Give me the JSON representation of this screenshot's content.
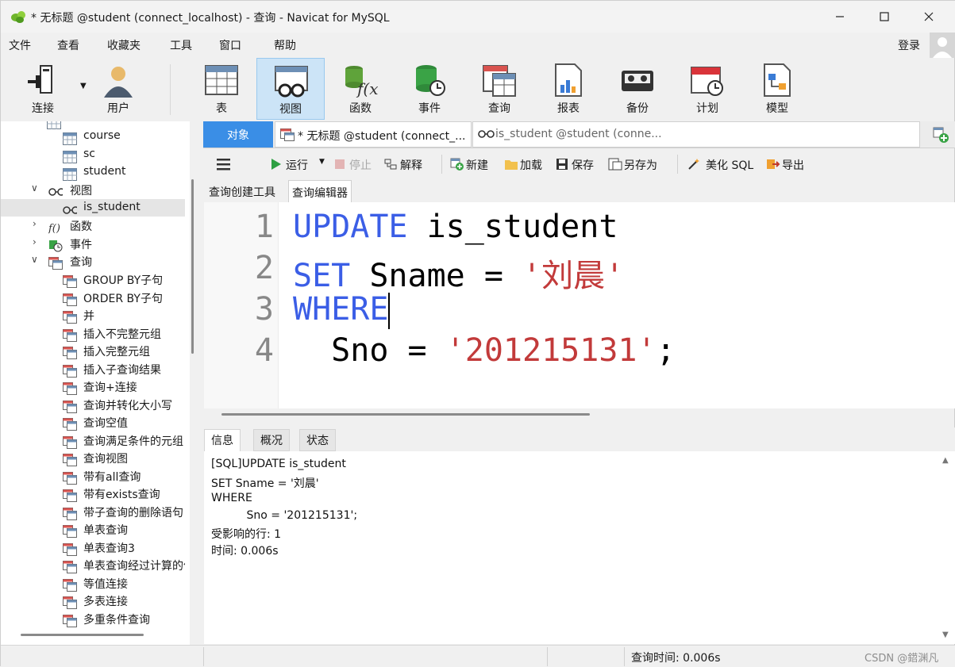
{
  "window": {
    "title": "* 无标题 @student (connect_localhost) - 查询 - Navicat for MySQL"
  },
  "menu": {
    "items": [
      "文件",
      "查看",
      "收藏夹",
      "工具",
      "窗口",
      "帮助"
    ],
    "login": "登录"
  },
  "toolbar": {
    "buttons": [
      {
        "label": "连接",
        "icon": "connection-icon"
      },
      {
        "label": "用户",
        "icon": "user-icon"
      },
      {
        "label": "表",
        "icon": "table-icon"
      },
      {
        "label": "视图",
        "icon": "view-icon"
      },
      {
        "label": "函数",
        "icon": "function-icon"
      },
      {
        "label": "事件",
        "icon": "event-icon"
      },
      {
        "label": "查询",
        "icon": "query-icon"
      },
      {
        "label": "报表",
        "icon": "report-icon"
      },
      {
        "label": "备份",
        "icon": "backup-icon"
      },
      {
        "label": "计划",
        "icon": "schedule-icon"
      },
      {
        "label": "模型",
        "icon": "model-icon"
      }
    ],
    "active": "视图"
  },
  "tree": {
    "tables": [
      "course",
      "sc",
      "student"
    ],
    "views_label": "视图",
    "views": [
      "is_student"
    ],
    "functions_label": "函数",
    "events_label": "事件",
    "queries_label": "查询",
    "queries": [
      "GROUP BY子句",
      "ORDER BY子句",
      "并",
      "插入不完整元组",
      "插入完整元组",
      "插入子查询结果",
      "查询+连接",
      "查询并转化大小写",
      "查询空值",
      "查询满足条件的元组",
      "查询视图",
      "带有all查询",
      "带有exists查询",
      "带子查询的删除语句",
      "单表查询",
      "单表查询3",
      "单表查询经过计算的值",
      "等值连接",
      "多表连接",
      "多重条件查询"
    ]
  },
  "doc_tabs": {
    "objects": "对象",
    "tab1": "* 无标题 @student (connect_...",
    "tab2": "is_student @student (conne..."
  },
  "query_toolbar": {
    "run": "运行",
    "stop": "停止",
    "explain": "解释",
    "new": "新建",
    "load": "加载",
    "save": "保存",
    "save_as": "另存为",
    "beautify": "美化 SQL",
    "export": "导出"
  },
  "editor_tabs": {
    "builder": "查询创建工具",
    "editor": "查询编辑器"
  },
  "code": {
    "line_numbers": [
      "1",
      "2",
      "3",
      "4"
    ],
    "l1_kw": "UPDATE",
    "l1_rest": " is_student",
    "l2_kw": "SET",
    "l2_mid": " Sname = ",
    "l2_str": "'刘晨'",
    "l3_kw": "WHERE",
    "l4_indent": "  Sno = ",
    "l4_str": "'201215131'",
    "l4_end": ";"
  },
  "bottom_tabs": [
    "信息",
    "概况",
    "状态"
  ],
  "info": {
    "lines": [
      "[SQL]UPDATE is_student",
      "SET Sname = '刘晨'",
      "WHERE",
      "          Sno = '201215131';",
      "受影响的行: 1",
      "时间: 0.006s"
    ]
  },
  "status": {
    "query_time": "查询时间: 0.006s",
    "watermark": "CSDN @鍣渊凡"
  }
}
